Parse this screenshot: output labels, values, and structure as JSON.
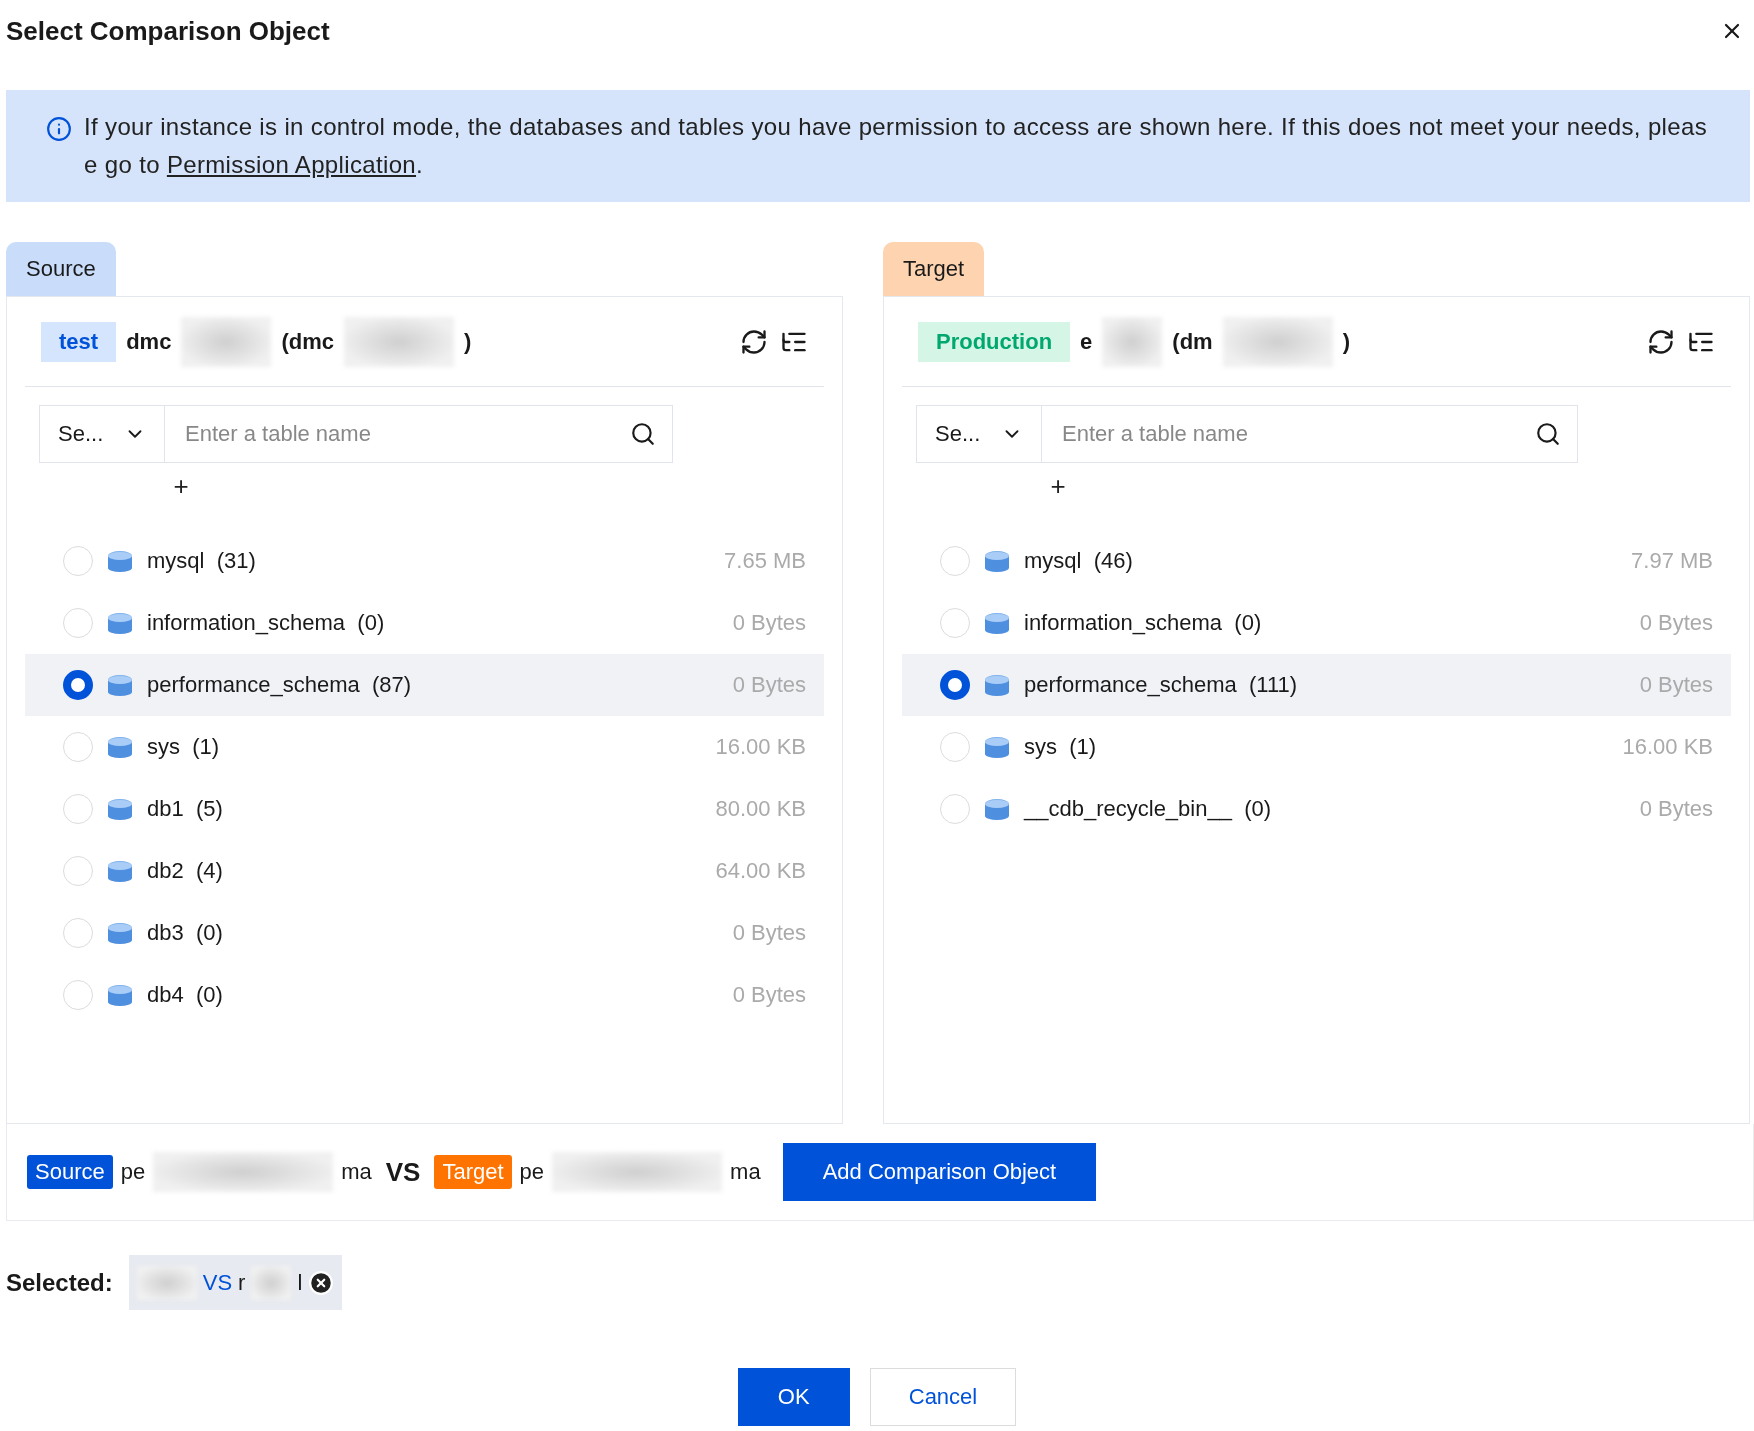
{
  "dialog": {
    "title": "Select Comparison Object"
  },
  "notice": {
    "text": "If your instance is in control mode, the databases and tables you have permission to access are shown here. If this does not meet your needs, please go to ",
    "link": "Permission Application",
    "end": "."
  },
  "panels": [
    {
      "kind": "source",
      "tab": "Source",
      "env": "test",
      "name_parts": [
        "dmc",
        "(dmc",
        ")"
      ],
      "select": "Se...",
      "placeholder": "Enter a table name",
      "add": "+",
      "databases": [
        {
          "name": "mysql",
          "count": "(31)",
          "size": "7.65 MB",
          "selected": false
        },
        {
          "name": "information_schema",
          "count": "(0)",
          "size": "0 Bytes",
          "selected": false
        },
        {
          "name": "performance_schema",
          "count": "(87)",
          "size": "0 Bytes",
          "selected": true
        },
        {
          "name": "sys",
          "count": "(1)",
          "size": "16.00 KB",
          "selected": false
        },
        {
          "name": "db1",
          "count": "(5)",
          "size": "80.00 KB",
          "selected": false
        },
        {
          "name": "db2",
          "count": "(4)",
          "size": "64.00 KB",
          "selected": false
        },
        {
          "name": "db3",
          "count": "(0)",
          "size": "0 Bytes",
          "selected": false
        },
        {
          "name": "db4",
          "count": "(0)",
          "size": "0 Bytes",
          "selected": false
        }
      ]
    },
    {
      "kind": "target",
      "tab": "Target",
      "env": "Production",
      "name_parts": [
        "e",
        "(dm",
        ")"
      ],
      "select": "Se...",
      "placeholder": "Enter a table name",
      "add": "+",
      "databases": [
        {
          "name": "mysql",
          "count": "(46)",
          "size": "7.97 MB",
          "selected": false
        },
        {
          "name": "information_schema",
          "count": "(0)",
          "size": "0 Bytes",
          "selected": false
        },
        {
          "name": "performance_schema",
          "count": "(111)",
          "size": "0 Bytes",
          "selected": true
        },
        {
          "name": "sys",
          "count": "(1)",
          "size": "16.00 KB",
          "selected": false
        },
        {
          "name": "__cdb_recycle_bin__",
          "count": "(0)",
          "size": "0 Bytes",
          "selected": false
        }
      ]
    }
  ],
  "comparison": {
    "source_tag": "Source",
    "source_parts": [
      "pe",
      "ma"
    ],
    "vs": "VS",
    "target_tag": "Target",
    "target_parts": [
      "pe",
      "ma"
    ],
    "button": "Add Comparison Object"
  },
  "selected": {
    "label": "Selected:",
    "vs": "VS",
    "parts": [
      "r",
      "l"
    ]
  },
  "buttons": {
    "ok": "OK",
    "cancel": "Cancel"
  }
}
